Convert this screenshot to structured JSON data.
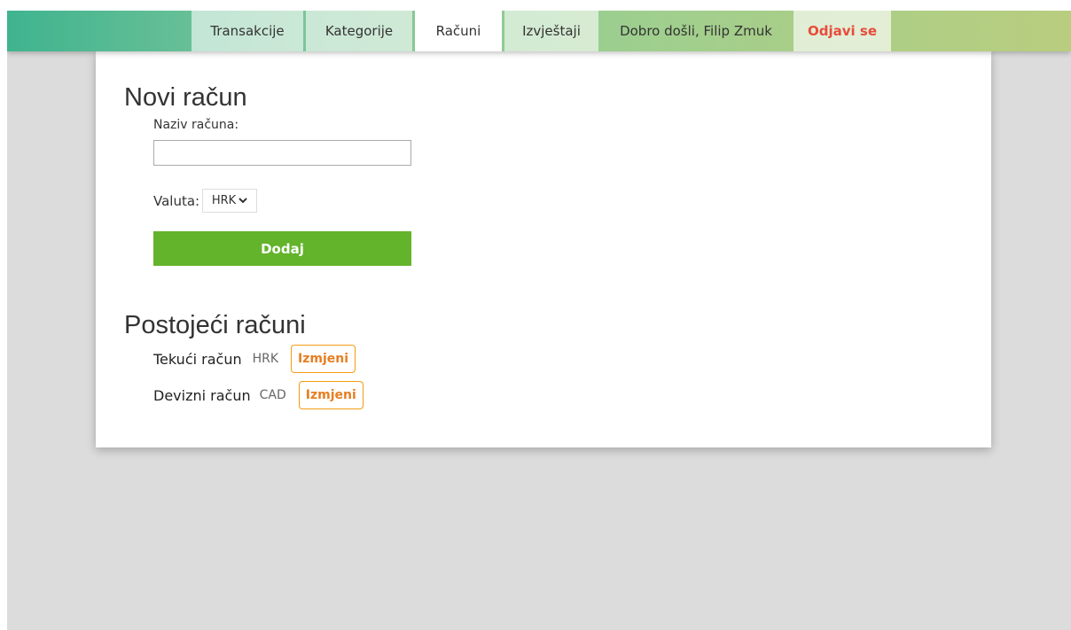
{
  "nav": {
    "tabs": [
      {
        "label": "Transakcije",
        "active": false
      },
      {
        "label": "Kategorije",
        "active": false
      },
      {
        "label": "Računi",
        "active": true
      },
      {
        "label": "Izvještaji",
        "active": false
      }
    ],
    "welcome": "Dobro došli, Filip Zmuk",
    "logout": "Odjavi se"
  },
  "new_account": {
    "title": "Novi račun",
    "name_label": "Naziv računa:",
    "name_value": "",
    "currency_label": "Valuta:",
    "currency_selected": "HRK",
    "add_button": "Dodaj"
  },
  "existing": {
    "title": "Postojeći računi",
    "accounts": [
      {
        "name": "Tekući račun",
        "currency": "HRK",
        "edit_label": "Izmjeni"
      },
      {
        "name": "Devizni račun",
        "currency": "CAD",
        "edit_label": "Izmjeni"
      }
    ]
  },
  "colors": {
    "add_button": "#63b32b",
    "logout": "#e74c3c",
    "edit_border": "#f39c12"
  }
}
